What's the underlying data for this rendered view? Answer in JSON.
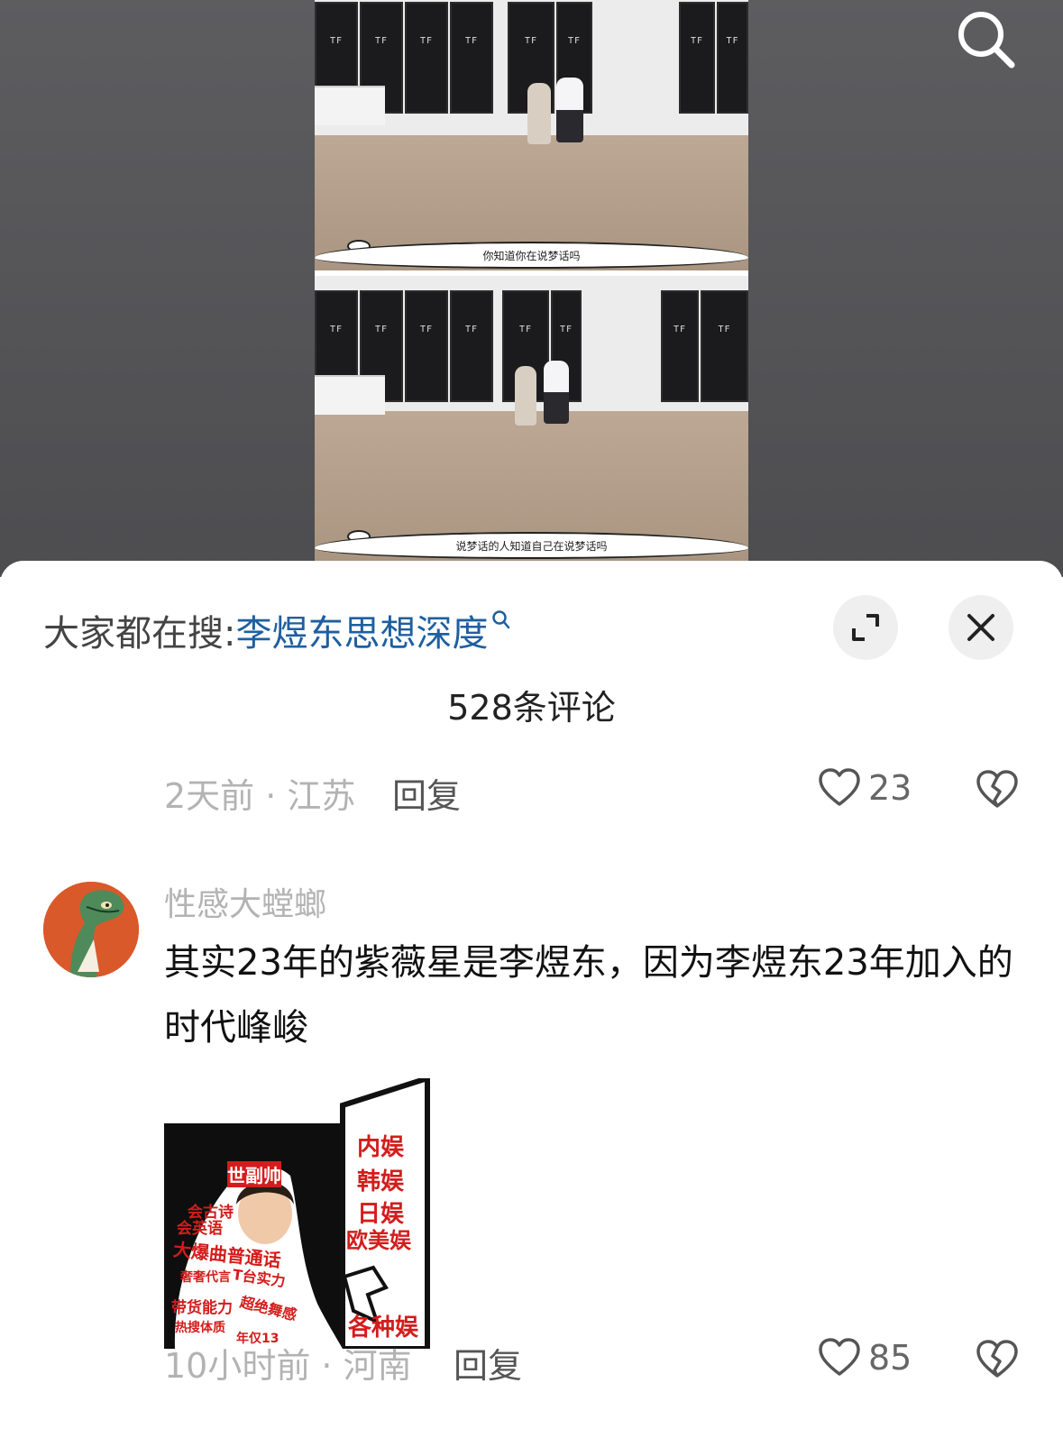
{
  "video": {
    "frames": [
      {
        "caption": "你知道你在说梦话吗"
      },
      {
        "caption": "说梦话的人知道自己在说梦话吗"
      }
    ]
  },
  "header": {
    "hot_prefix": "大家都在搜:",
    "hot_keyword": "李煜东思想深度"
  },
  "comments_count": "528条评论",
  "comments": [
    {
      "meta": "2天前 · 江苏",
      "reply_label": "回复",
      "likes": "23"
    },
    {
      "username": "性感大螳螂",
      "text": "其实23年的紫薇星是李煜东，因为李煜东23年加入的时代峰峻",
      "meta": "10小时前 · 河南",
      "reply_label": "回复",
      "likes": "85",
      "meme_texts": {
        "top_label": "世副帅",
        "left_lines": [
          "会古诗",
          "会英语",
          "大爆曲普通话",
          "奢奢代言",
          "T台实力",
          "带货能力",
          "超绝舞感",
          "热搜体质",
          "年仅13"
        ],
        "right_lines": [
          "内娱",
          "韩娱",
          "日娱",
          "欧美娱",
          "各种娱"
        ]
      }
    }
  ],
  "colors": {
    "accent_link": "#1e5fa0",
    "meta_gray": "#b3b3b3",
    "meme_red": "#d41c1c"
  }
}
